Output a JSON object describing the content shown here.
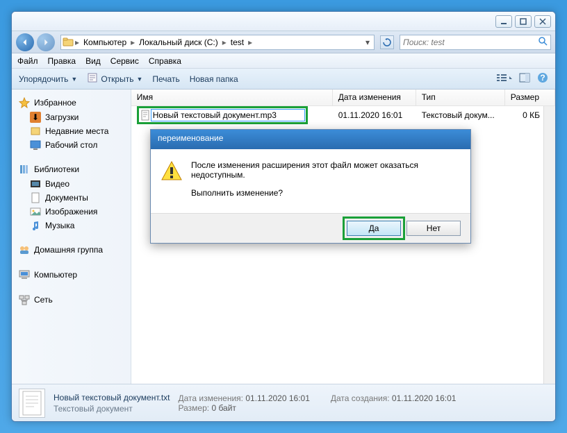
{
  "window_controls": {
    "min": "min",
    "max": "max",
    "close": "close"
  },
  "breadcrumb": {
    "parts": [
      "Компьютер",
      "Локальный диск (C:)",
      "test"
    ]
  },
  "search": {
    "placeholder": "Поиск: test"
  },
  "menubar": [
    "Файл",
    "Правка",
    "Вид",
    "Сервис",
    "Справка"
  ],
  "toolbar": {
    "organize": "Упорядочить",
    "open": "Открыть",
    "print": "Печать",
    "newfolder": "Новая папка"
  },
  "sidebar": {
    "favorites": {
      "label": "Избранное",
      "items": [
        "Загрузки",
        "Недавние места",
        "Рабочий стол"
      ]
    },
    "libraries": {
      "label": "Библиотеки",
      "items": [
        "Видео",
        "Документы",
        "Изображения",
        "Музыка"
      ]
    },
    "homegroup": {
      "label": "Домашняя группа"
    },
    "computer": {
      "label": "Компьютер"
    },
    "network": {
      "label": "Сеть"
    }
  },
  "columns": {
    "name": "Имя",
    "date": "Дата изменения",
    "type": "Тип",
    "size": "Размер"
  },
  "file": {
    "rename_value": "Новый текстовый документ.mp3",
    "date": "01.11.2020 16:01",
    "type": "Текстовый докум...",
    "size": "0 КБ"
  },
  "dialog": {
    "title": "переименование",
    "line1": "После изменения расширения этот файл может оказаться недоступным.",
    "line2": "Выполнить изменение?",
    "yes": "Да",
    "no": "Нет"
  },
  "details": {
    "filename": "Новый текстовый документ.txt",
    "filetype": "Текстовый документ",
    "modified_label": "Дата изменения:",
    "modified": "01.11.2020 16:01",
    "size_label": "Размер:",
    "size": "0 байт",
    "created_label": "Дата создания:",
    "created": "01.11.2020 16:01"
  }
}
